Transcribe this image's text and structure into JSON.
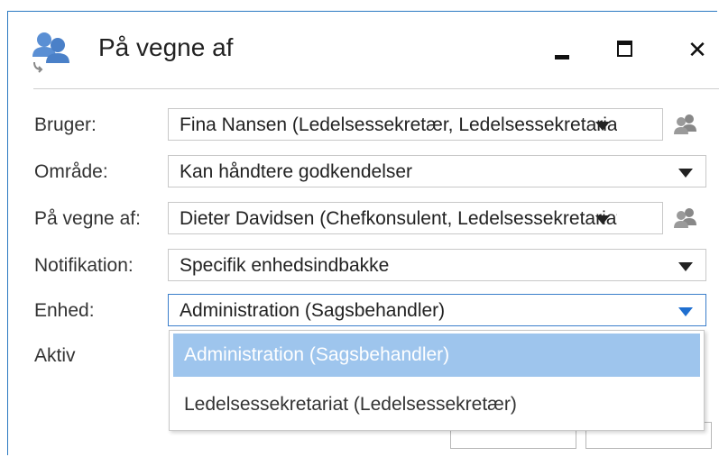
{
  "window": {
    "title": "På vegne af"
  },
  "form": {
    "bruger": {
      "label": "Bruger:",
      "value": "Fina Nansen (Ledelsessekretær, Ledelsessekretariat)"
    },
    "omraade": {
      "label": "Område:",
      "value": "Kan håndtere godkendelser"
    },
    "paa_vegne_af": {
      "label": "På vegne af:",
      "value": "Dieter Davidsen (Chefkonsulent, Ledelsessekretariat)"
    },
    "notifikation": {
      "label": "Notifikation:",
      "value": "Specifik enhedsindbakke"
    },
    "enhed": {
      "label": "Enhed:",
      "value": "Administration (Sagsbehandler)",
      "options": [
        "Administration (Sagsbehandler)",
        "Ledelsessekretariat (Ledelsessekretær)"
      ]
    },
    "aktiv": {
      "label": "Aktiv"
    }
  },
  "colors": {
    "accent": "#2b79c2",
    "selected_option": "#9ec5ed"
  },
  "icons": [
    "users-switch-icon",
    "minimize-icon",
    "maximize-icon",
    "close-icon",
    "people-picker-icon",
    "chevron-down-icon"
  ]
}
